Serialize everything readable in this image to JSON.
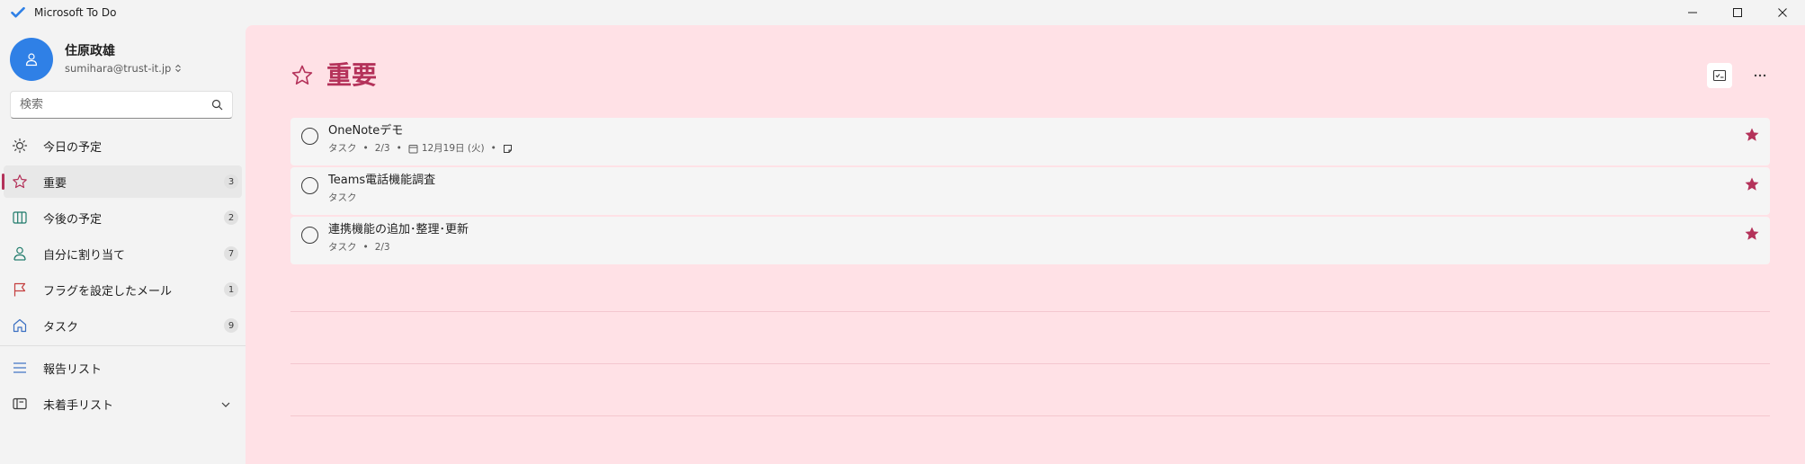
{
  "window": {
    "title": "Microsoft To Do"
  },
  "account": {
    "name": "住原政雄",
    "email": "sumihara@trust-it.jp"
  },
  "search": {
    "placeholder": "検索",
    "value": ""
  },
  "nav": {
    "items": [
      {
        "label": "今日の予定",
        "icon": "sun-icon",
        "count": ""
      },
      {
        "label": "重要",
        "icon": "star-icon",
        "count": "3"
      },
      {
        "label": "今後の予定",
        "icon": "calendar-grid-icon",
        "count": "2"
      },
      {
        "label": "自分に割り当て",
        "icon": "person-icon",
        "count": "7"
      },
      {
        "label": "フラグを設定したメール",
        "icon": "flag-icon",
        "count": "1"
      },
      {
        "label": "タスク",
        "icon": "home-icon",
        "count": "9"
      }
    ],
    "lists": [
      {
        "label": "報告リスト",
        "icon": "list-icon"
      },
      {
        "label": "未着手リスト",
        "icon": "group-icon"
      }
    ]
  },
  "page": {
    "title": "重要",
    "accent_color": "#b4325a",
    "background_color": "#ffe1e6"
  },
  "tasks": [
    {
      "title": "OneNoteデモ",
      "list": "タスク",
      "steps": "2/3",
      "due": "12月19日 (火)",
      "has_note": true,
      "important": true
    },
    {
      "title": "Teams電話機能調査",
      "list": "タスク",
      "important": true
    },
    {
      "title": "連携機能の追加･整理･更新",
      "list": "タスク",
      "steps": "2/3",
      "important": true
    }
  ]
}
